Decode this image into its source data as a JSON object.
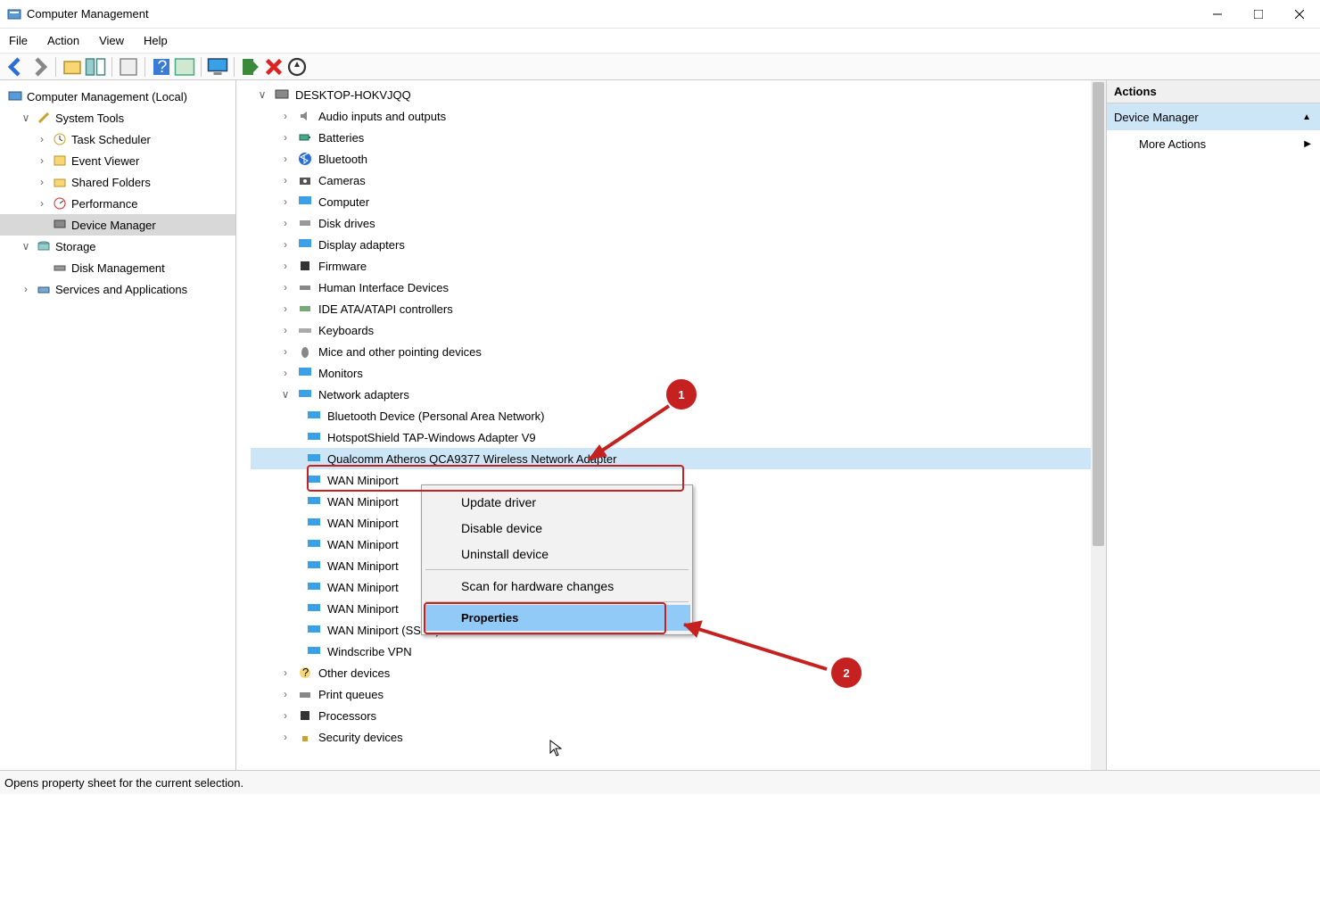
{
  "window": {
    "title": "Computer Management"
  },
  "menu": {
    "file": "File",
    "action": "Action",
    "view": "View",
    "help": "Help"
  },
  "left_tree": {
    "root": "Computer Management (Local)",
    "system_tools": "System Tools",
    "task_scheduler": "Task Scheduler",
    "event_viewer": "Event Viewer",
    "shared_folders": "Shared Folders",
    "performance": "Performance",
    "device_manager": "Device Manager",
    "storage": "Storage",
    "disk_management": "Disk Management",
    "services_apps": "Services and Applications"
  },
  "devices": {
    "root": "DESKTOP-HOKVJQQ",
    "audio": "Audio inputs and outputs",
    "batteries": "Batteries",
    "bluetooth": "Bluetooth",
    "cameras": "Cameras",
    "computer": "Computer",
    "diskdrives": "Disk drives",
    "display": "Display adapters",
    "firmware": "Firmware",
    "hid": "Human Interface Devices",
    "ide": "IDE ATA/ATAPI controllers",
    "keyboards": "Keyboards",
    "mice": "Mice and other pointing devices",
    "monitors": "Monitors",
    "netadapters": "Network adapters",
    "net_items": [
      "Bluetooth Device (Personal Area Network)",
      "HotspotShield TAP-Windows Adapter V9",
      "Qualcomm Atheros QCA9377 Wireless Network Adapter",
      "WAN Miniport",
      "WAN Miniport",
      "WAN Miniport",
      "WAN Miniport",
      "WAN Miniport",
      "WAN Miniport",
      "WAN Miniport",
      "WAN Miniport (SSTP)",
      "Windscribe VPN"
    ],
    "other": "Other devices",
    "printq": "Print queues",
    "processors": "Processors",
    "security": "Security devices"
  },
  "context_menu": {
    "update": "Update driver",
    "disable": "Disable device",
    "uninstall": "Uninstall device",
    "scan": "Scan for hardware changes",
    "properties": "Properties"
  },
  "actions_pane": {
    "header": "Actions",
    "section": "Device Manager",
    "more": "More Actions"
  },
  "status": "Opens property sheet for the current selection.",
  "annotations": {
    "b1": "1",
    "b2": "2"
  }
}
